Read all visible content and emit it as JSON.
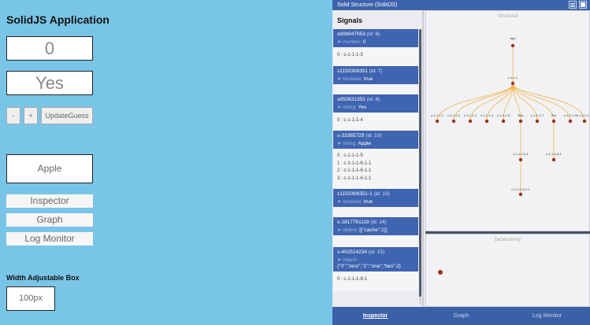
{
  "app": {
    "title": "SolidJS Application",
    "counter_value": "0",
    "boolean_value": "Yes",
    "decrement_label": "-",
    "increment_label": "+",
    "update_guess_label": "UpdateGuess",
    "fruit_value": "Apple",
    "inspector_button": "Inspector",
    "graph_button": "Graph",
    "log_monitor_button": "Log Monitor",
    "adjustable_title": "Width Adjustable Box",
    "adjustable_value": "100px"
  },
  "devtools": {
    "title": "Solid Structure (SolidJS)",
    "signals_heading": "Signals",
    "signals": [
      {
        "name": "s606947053",
        "id": "(id: 6)",
        "type": "➤ number:",
        "value": "0",
        "children": [
          "0 : c-1-1-1-3"
        ]
      },
      {
        "name": "s1150306351",
        "id": "(id: 7)",
        "type": "➤ boolean:",
        "value": "true",
        "children": []
      },
      {
        "name": "s850631353",
        "id": "(id: 8)",
        "type": "➤ string:",
        "value": "Yes",
        "children": [
          "0 : c-1-1-1-4"
        ]
      },
      {
        "name": "s-33385729",
        "id": "(id: 10)",
        "type": "➤ string:",
        "value": "Apple",
        "children": [
          "0 : c-1-1-1-5",
          "1 : c-1-1-1-6-1-1",
          "2 : c-1-1-1-6-1-1",
          "3 : c-1-1-1-6-1-1"
        ]
      },
      {
        "name": "s1150306351-1",
        "id": "(id: 13)",
        "type": "➤ boolean:",
        "value": "true",
        "children": []
      },
      {
        "name": "s-1817761118",
        "id": "(id: 14)",
        "type": "➤ object:",
        "value": "[{\"cache\":1}]",
        "children": []
      },
      {
        "name": "s-402514234",
        "id": "(id: 15)",
        "type": "➤ object:",
        "value": "{\"0\":\"zero\",\"1\":\"one\",\"two\":2}",
        "children": [
          "0 : c-1-1-1-8-1"
        ]
      }
    ],
    "structural_label": "Structural",
    "dependency_label": "Dependency",
    "tree": {
      "root": "App",
      "level1": "c-1-1-1",
      "level2": [
        "c-1-1-1-1",
        "c-1-1-1-2",
        "c-1-1-1-3",
        "c-1-1-1-4",
        "c-1-1-1-5",
        "Nav",
        "c-1-1-1-7",
        "Par",
        "c-1-1-1-9",
        "c-1-1-1-10"
      ],
      "nav_child": "c-1-1-1-6-1",
      "par_child": "c-1-1-1-8-1",
      "nav_grandchild": "c-1-1-1-6-1-1"
    },
    "tabs": [
      "Inspector",
      "Graph",
      "Log Monitor"
    ],
    "active_tab": "Inspector",
    "colors": {
      "panel_blue": "#3d63ad",
      "node": "#a0301a",
      "edge": "#f1b24a",
      "app_bg": "#79c5e8"
    }
  }
}
